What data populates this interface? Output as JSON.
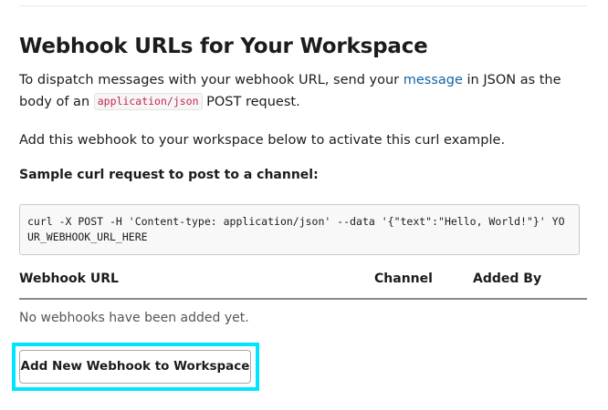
{
  "heading": "Webhook URLs for Your Workspace",
  "intro": {
    "prefix": "To dispatch messages with your webhook URL, send your ",
    "link_text": "message",
    "middle": " in JSON as the body of an ",
    "code": "application/json",
    "suffix": " POST request."
  },
  "activate_text": "Add this webhook to your workspace below to activate this curl example.",
  "sample_heading": "Sample curl request to post to a channel:",
  "sample_code": "curl -X POST -H 'Content-type: application/json' --data '{\"text\":\"Hello, World!\"}' YOUR_WEBHOOK_URL_HERE",
  "table": {
    "columns": [
      "Webhook URL",
      "Channel",
      "Added By"
    ],
    "empty_message": "No webhooks have been added yet."
  },
  "add_button_label": "Add New Webhook to Workspace",
  "colors": {
    "link": "#1264a3",
    "inline_code": "#c7254e",
    "highlight": "#00e5ff"
  }
}
